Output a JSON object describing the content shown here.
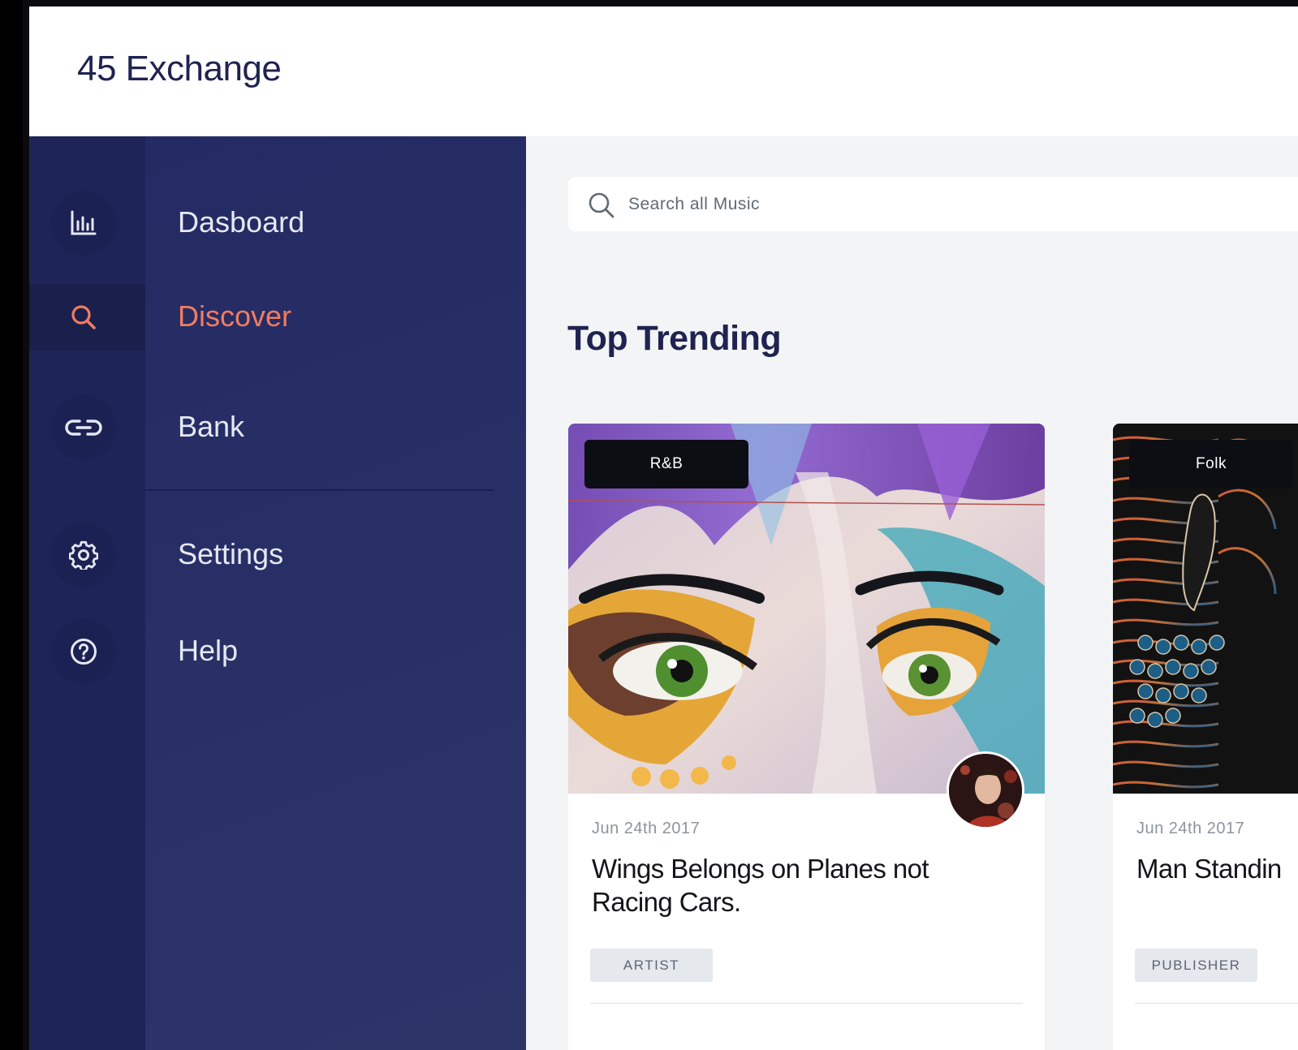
{
  "app": {
    "title": "45 Exchange"
  },
  "sidebar": {
    "items": [
      {
        "label": "Dasboard",
        "icon": "bar-chart-icon",
        "active": false
      },
      {
        "label": "Discover",
        "icon": "search-icon",
        "active": true
      },
      {
        "label": "Bank",
        "icon": "link-icon",
        "active": false
      },
      {
        "label": "Settings",
        "icon": "gear-icon",
        "active": false
      },
      {
        "label": "Help",
        "icon": "help-circle-icon",
        "active": false
      }
    ]
  },
  "search": {
    "placeholder": "Search all Music",
    "value": ""
  },
  "main": {
    "section_title": "Top Trending",
    "cards": [
      {
        "genre": "R&B",
        "date": "Jun 24th 2017",
        "title": "Wings Belongs on Planes not Racing Cars.",
        "role": "ARTIST"
      },
      {
        "genre": "Folk",
        "date": "Jun 24th 2017",
        "title": "Man Standin",
        "role": "PUBLISHER"
      }
    ]
  },
  "colors": {
    "brand_navy": "#1f2350",
    "sidebar_bg": "#262c64",
    "accent": "#f27c5f",
    "content_bg": "#f3f4f6"
  }
}
